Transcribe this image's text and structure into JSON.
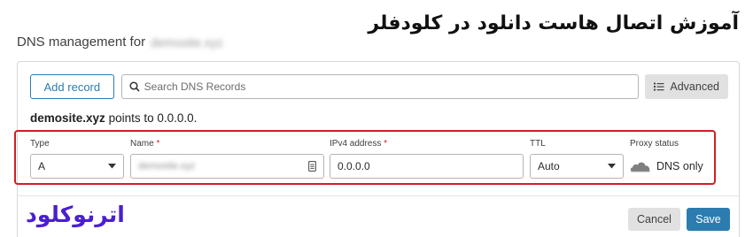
{
  "overlay_title": "آموزش اتصال هاست دانلود در کلودفلر",
  "page": {
    "heading": "DNS management for",
    "heading_domain": "demosite.xyz"
  },
  "toolbar": {
    "add_record_label": "Add record",
    "search_placeholder": "Search DNS Records",
    "advanced_label": "Advanced"
  },
  "points_line": {
    "domain": "demosite.xyz",
    "text": "points to 0.0.0.0."
  },
  "form": {
    "type": {
      "label": "Type",
      "value": "A"
    },
    "name": {
      "label": "Name",
      "required_mark": "*",
      "value": "demosite.xyz"
    },
    "ipv4": {
      "label": "IPv4 address",
      "required_mark": "*",
      "value": "0.0.0.0"
    },
    "ttl": {
      "label": "TTL",
      "value": "Auto"
    },
    "proxy": {
      "label": "Proxy status",
      "value": "DNS only",
      "icon": "cloud-icon"
    }
  },
  "footer": {
    "brand": "اترنوکلود",
    "cancel_label": "Cancel",
    "save_label": "Save"
  },
  "colors": {
    "accent": "#2c7cb0",
    "highlight_border": "#d11f23",
    "brand": "#4a1fd1"
  }
}
